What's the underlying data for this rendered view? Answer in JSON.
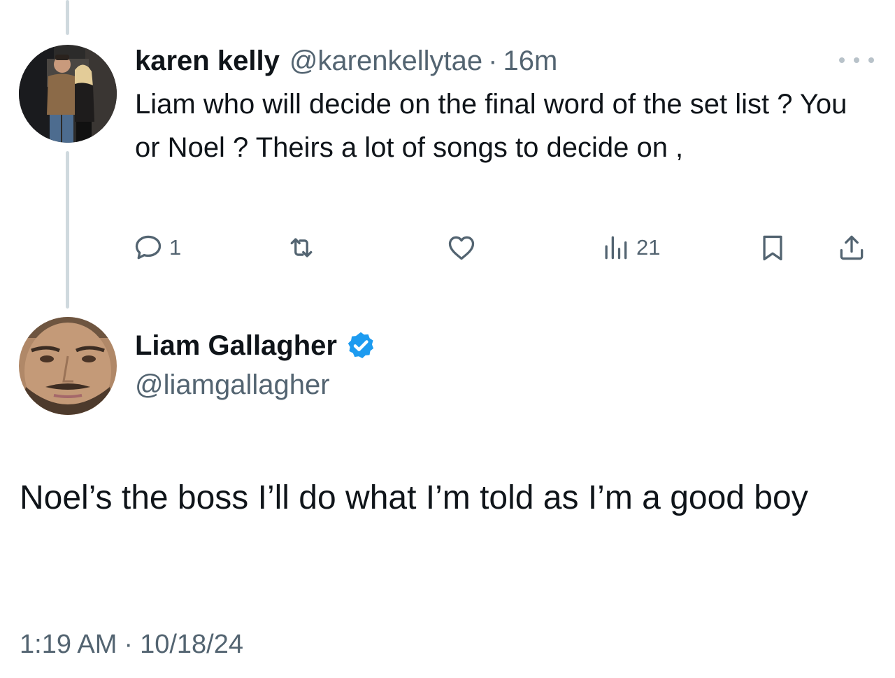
{
  "reply_tweet": {
    "display_name": "karen kelly",
    "handle": "@karenkellytae",
    "separator": "·",
    "time_ago": "16m",
    "text": "Liam who will decide on the final word of the set list ? You or Noel  ? Theirs a lot of songs to decide on ,",
    "actions": {
      "reply_count": "1",
      "views_count": "21"
    },
    "avatar_icon": "user-photo-avatar"
  },
  "main_tweet": {
    "display_name": "Liam Gallagher",
    "handle": "@liamgallagher",
    "verified": true,
    "verified_color": "#1d9bf0",
    "text": "Noel’s the boss I’ll do what I’m told as I’m a good boy",
    "time": "1:19 AM",
    "separator": "·",
    "date": "10/18/24",
    "avatar_icon": "user-photo-avatar"
  },
  "colors": {
    "text_primary": "#0f1419",
    "text_secondary": "#536471",
    "thread_line": "#cfd9de",
    "verified": "#1d9bf0"
  }
}
